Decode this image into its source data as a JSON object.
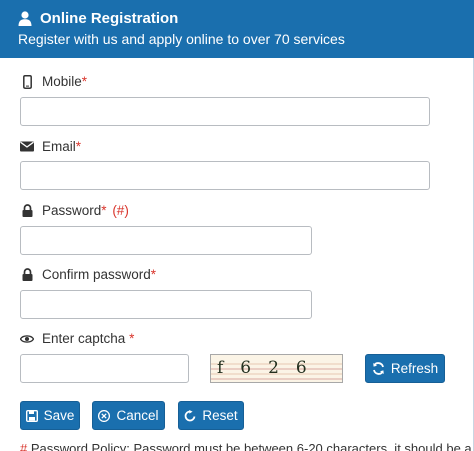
{
  "header": {
    "title": "Online Registration",
    "subtitle": "Register with us and apply online to over 70 services"
  },
  "form": {
    "mobile": {
      "label": "Mobile",
      "required": "*",
      "value": "",
      "icon": "mobile-icon"
    },
    "email": {
      "label": "Email",
      "required": "*",
      "value": "",
      "icon": "envelope-icon"
    },
    "password": {
      "label": "Password",
      "required": "*",
      "hint": "(#)",
      "value": "",
      "icon": "lock-icon"
    },
    "confirm_password": {
      "label": "Confirm password",
      "required": "*",
      "value": "",
      "icon": "lock-icon"
    },
    "captcha": {
      "label": "Enter captcha",
      "required": "*",
      "value": "",
      "image_text": "f626",
      "icon": "eye-icon"
    }
  },
  "buttons": {
    "refresh": "Refresh",
    "save": "Save",
    "cancel": "Cancel",
    "reset": "Reset"
  },
  "policy": {
    "mark": "#",
    "text": "Password Policy: Password must be between 6-20 characters, it should be a"
  },
  "colors": {
    "accent": "#1a6fae",
    "required": "#d9342b"
  }
}
